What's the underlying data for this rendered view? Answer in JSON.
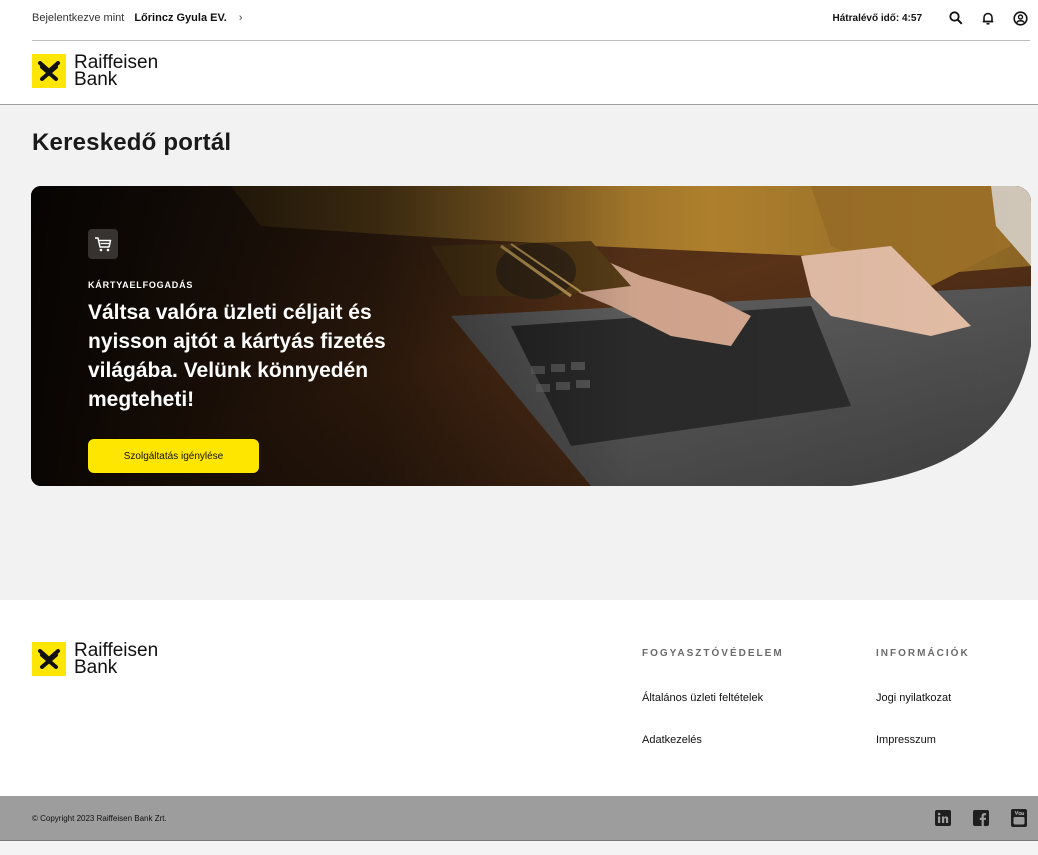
{
  "topbar": {
    "login_label": "Bejelentkezve mint",
    "user_name": "Lőrincz Gyula EV.",
    "chevron": "›",
    "timer_label": "Hátralévő idő:",
    "timer_value": "4:57",
    "icons": [
      "search-icon",
      "bell-icon",
      "user-icon"
    ]
  },
  "logo": {
    "line1": "Raiffeisen",
    "line2": "Bank"
  },
  "main": {
    "title": "Kereskedő portál",
    "hero": {
      "eyebrow": "KÁRTYAELFOGADÁS",
      "headline": "Váltsa valóra üzleti céljait és nyisson ajtót a kártyás fizetés világába. Velünk könnyedén megteheti!",
      "cta": "Szolgáltatás igénylése",
      "icon": "cart-icon"
    }
  },
  "footer": {
    "col1": {
      "heading": "FOGYASZTÓVÉDELEM",
      "links": [
        "Általános üzleti feltételek",
        "Adatkezelés"
      ]
    },
    "col2": {
      "heading": "INFORMÁCIÓK",
      "links": [
        "Jogi nyilatkozat",
        "Impresszum"
      ]
    },
    "copyright": "© Copyright 2023 Raiffeisen Bank Zrt.",
    "social": [
      "linkedin-icon",
      "facebook-icon",
      "youtube-icon"
    ]
  },
  "colors": {
    "brand_yellow": "#ffe600",
    "page_bg": "#f2f2f2",
    "bottom_bar": "#9d9d9d"
  }
}
